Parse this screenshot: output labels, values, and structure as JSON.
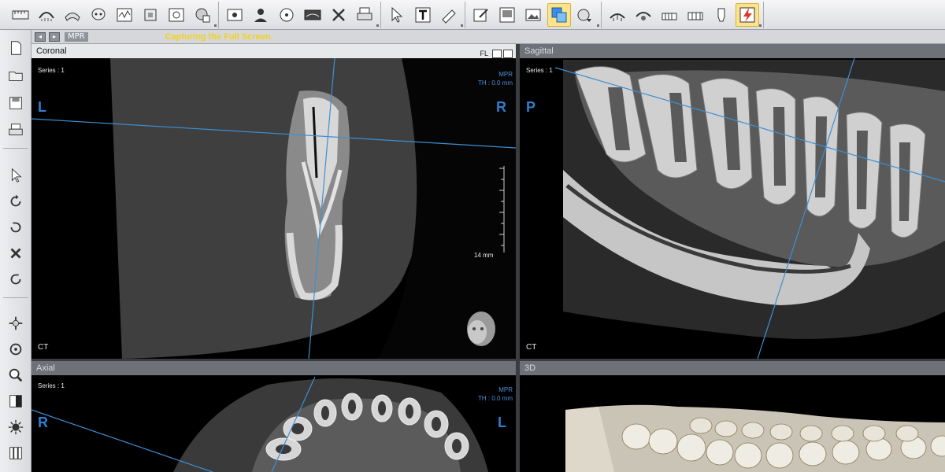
{
  "toolbar": {
    "groups": [
      {
        "buttons": [
          "ruler-icon",
          "panoramic-icon",
          "jaw-icon",
          "skull-icon",
          "waveform-icon",
          "crop-icon",
          "capture-icon",
          "layers-icon"
        ]
      },
      {
        "buttons": [
          "photo-icon",
          "patient-icon",
          "disc-icon",
          "xray-icon",
          "tools-icon",
          "print-icon"
        ]
      },
      {
        "buttons": [
          "pointer-icon",
          "text-icon",
          "eraser-icon"
        ]
      },
      {
        "buttons": [
          "edit-icon",
          "report-icon",
          "image-icon",
          "overlay-icon",
          "export-icon"
        ]
      },
      {
        "buttons": [
          "implant-icon",
          "nerve-icon",
          "ortho-icon",
          "teeth-icon",
          "crown-icon",
          "flash-icon"
        ]
      }
    ],
    "active_buttons": [
      "overlay-icon",
      "flash-icon"
    ]
  },
  "statusbar": {
    "mode_label": "MPR",
    "message": "Capturing the Full Screen."
  },
  "left_tools": [
    "new-file-icon",
    "open-folder-icon",
    "save-icon",
    "print-icon",
    "pointer-icon",
    "rotate-icon",
    "undo-icon",
    "close-icon",
    "redo-icon",
    "pan-icon",
    "reset-icon",
    "zoom-icon",
    "contrast-icon",
    "brightness-icon",
    "film-icon"
  ],
  "views": {
    "coronal": {
      "title": "Coronal",
      "series": "Series : 1",
      "mpr": "MPR",
      "thickness": "TH : 0.0 mm",
      "left_orient": "L",
      "right_orient": "R",
      "modality": "CT",
      "scale_label": "14 mm",
      "fl_label": "FL"
    },
    "sagittal": {
      "title": "Sagittal",
      "series": "Series : 1",
      "left_orient": "P",
      "modality": "CT"
    },
    "axial": {
      "title": "Axial",
      "series": "Series : 1",
      "mpr": "MPR",
      "thickness": "TH : 0.0 mm",
      "left_orient": "R",
      "right_orient": "L"
    },
    "three_d": {
      "title": "3D"
    }
  },
  "colors": {
    "accent_blue": "#2e7fd0",
    "status_yellow": "#f3d21b",
    "active_button": "#fde38a"
  }
}
